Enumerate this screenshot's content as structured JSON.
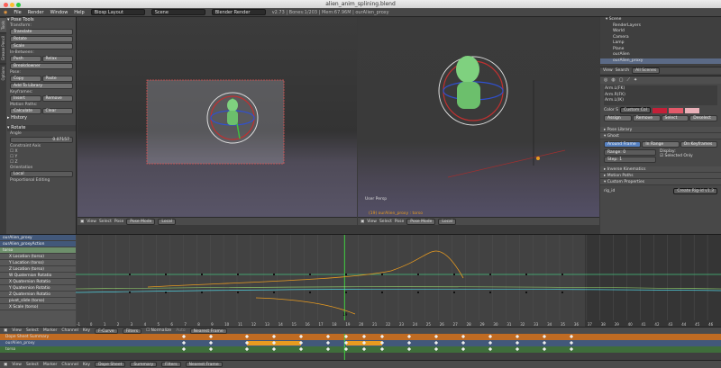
{
  "window": {
    "title": "alien_anim_splining.blend"
  },
  "menubar": {
    "items": [
      "File",
      "Render",
      "Window",
      "Help"
    ],
    "layout": "Biosp Layout",
    "scene": "Scene",
    "engine": "Blender Render",
    "stats": "v2.73 | Bones:1/203 | Mem:67.96M | ourAlien_proxy"
  },
  "tool_shelf": {
    "tabs": [
      "Tools",
      "Grease Pencil",
      "Options"
    ],
    "panel_title": "Pose Tools",
    "transform_label": "Transform:",
    "transform_buttons": [
      "Translate",
      "Rotate",
      "Scale"
    ],
    "inbetween_label": "In-Between:",
    "push": "Push",
    "relax": "Relax",
    "breakdowner": "Breakdowner",
    "pose_label": "Pose:",
    "copy": "Copy",
    "paste": "Paste",
    "add_to_library": "Add To Library",
    "keyframes_label": "Keyframes:",
    "insert": "Insert",
    "remove": "Remove",
    "motion_paths_label": "Motion Paths:",
    "calculate": "Calculate",
    "clear": "Clear",
    "history": "History",
    "rotate_title": "Rotate",
    "angle_label": "Angle",
    "angle_value": "0.07157",
    "constraint_label": "Constraint Axis",
    "axes": [
      "X",
      "Y",
      "Z"
    ],
    "orientation_label": "Orientation",
    "orientation_value": "Local",
    "proportional": "Proportional Editing"
  },
  "viewport_left": {
    "header": [
      "View",
      "Select",
      "Pose"
    ],
    "mode": "Pose Mode",
    "pivot": "Local"
  },
  "viewport_right": {
    "label": "User Persp",
    "frame_label": "(19) ourAlien_proxy : torso",
    "header": [
      "View",
      "Select",
      "Pose"
    ],
    "mode": "Pose Mode",
    "pivot": "Local"
  },
  "outliner": {
    "items": [
      "Scene",
      "RenderLayers",
      "World",
      "Camera",
      "Lamp",
      "Plane",
      "ourAlien",
      "ourAlien_proxy"
    ],
    "header": [
      "View",
      "Search"
    ],
    "filter": "All Scenes"
  },
  "properties": {
    "bone_groups": [
      "Arm.L(FK)",
      "Arm.R(FK)",
      "Arm.L(IK)"
    ],
    "color_set_label": "Color S",
    "color_set_value": "Custom Col",
    "assign_buttons": [
      "Assign",
      "Remove",
      "Select",
      "Deselect"
    ],
    "panels": [
      "Pose Library",
      "Ghost"
    ],
    "ghost_tabs": [
      "Around Frame",
      "In Range",
      "On Keyframes"
    ],
    "range_label": "Range",
    "range_value": "0",
    "step_label": "Step",
    "step_value": "1",
    "display_label": "Display:",
    "selected_only": "Selected Only",
    "more_panels": [
      "Inverse Kinematics",
      "Motion Paths",
      "Custom Properties"
    ],
    "rig_id_label": "rig_id",
    "rig_id_value": "Create Rig-id v1.3"
  },
  "dope": {
    "channels": [
      {
        "label": "ourAlien_proxy",
        "kind": "obj"
      },
      {
        "label": "ourAlien_proxyAction",
        "kind": "obj"
      },
      {
        "label": "torso",
        "kind": "act"
      },
      {
        "label": "X Location (torso)",
        "kind": "sub"
      },
      {
        "label": "Y Location (torso)",
        "kind": "sub"
      },
      {
        "label": "Z Location (torso)",
        "kind": "sub"
      },
      {
        "label": "W Quaternion Rotatio",
        "kind": "sub"
      },
      {
        "label": "X Quaternion Rotatio",
        "kind": "sub"
      },
      {
        "label": "Y Quaternion Rotatio",
        "kind": "sub"
      },
      {
        "label": "Z Quaternion Rotatio",
        "kind": "sub"
      },
      {
        "label": "pivot_slide (torso)",
        "kind": "sub"
      },
      {
        "label": "X Scale (torso)",
        "kind": "sub"
      }
    ],
    "frames": [
      "-1",
      "0",
      "1",
      "2",
      "3",
      "4",
      "5",
      "6",
      "7",
      "8",
      "9",
      "10",
      "11",
      "12",
      "13",
      "14",
      "15",
      "16",
      "17",
      "18",
      "19",
      "20",
      "21",
      "22",
      "23",
      "24",
      "25",
      "26",
      "27",
      "28",
      "29",
      "30",
      "31",
      "32",
      "33",
      "34",
      "35",
      "36",
      "37",
      "38",
      "39",
      "40",
      "41",
      "42",
      "43",
      "44",
      "45",
      "46"
    ],
    "current_frame": "19"
  },
  "graph_header": {
    "items": [
      "View",
      "Select",
      "Marker",
      "Channel",
      "Key"
    ],
    "mode": "F-Curve",
    "filters": "Filters",
    "normalize": "Normalize",
    "auto": "Auto",
    "snap": "Nearest Frame"
  },
  "dopesheet_summary": {
    "rows": [
      "Dope Sheet Summary",
      "ourAlien_proxy",
      "torso"
    ]
  },
  "timeline": {
    "items": [
      "View",
      "Select",
      "Marker",
      "Channel",
      "Key"
    ],
    "mode": "Dope Sheet",
    "summary": "Summary",
    "filters": "Filters",
    "snap": "Nearest Frame"
  }
}
